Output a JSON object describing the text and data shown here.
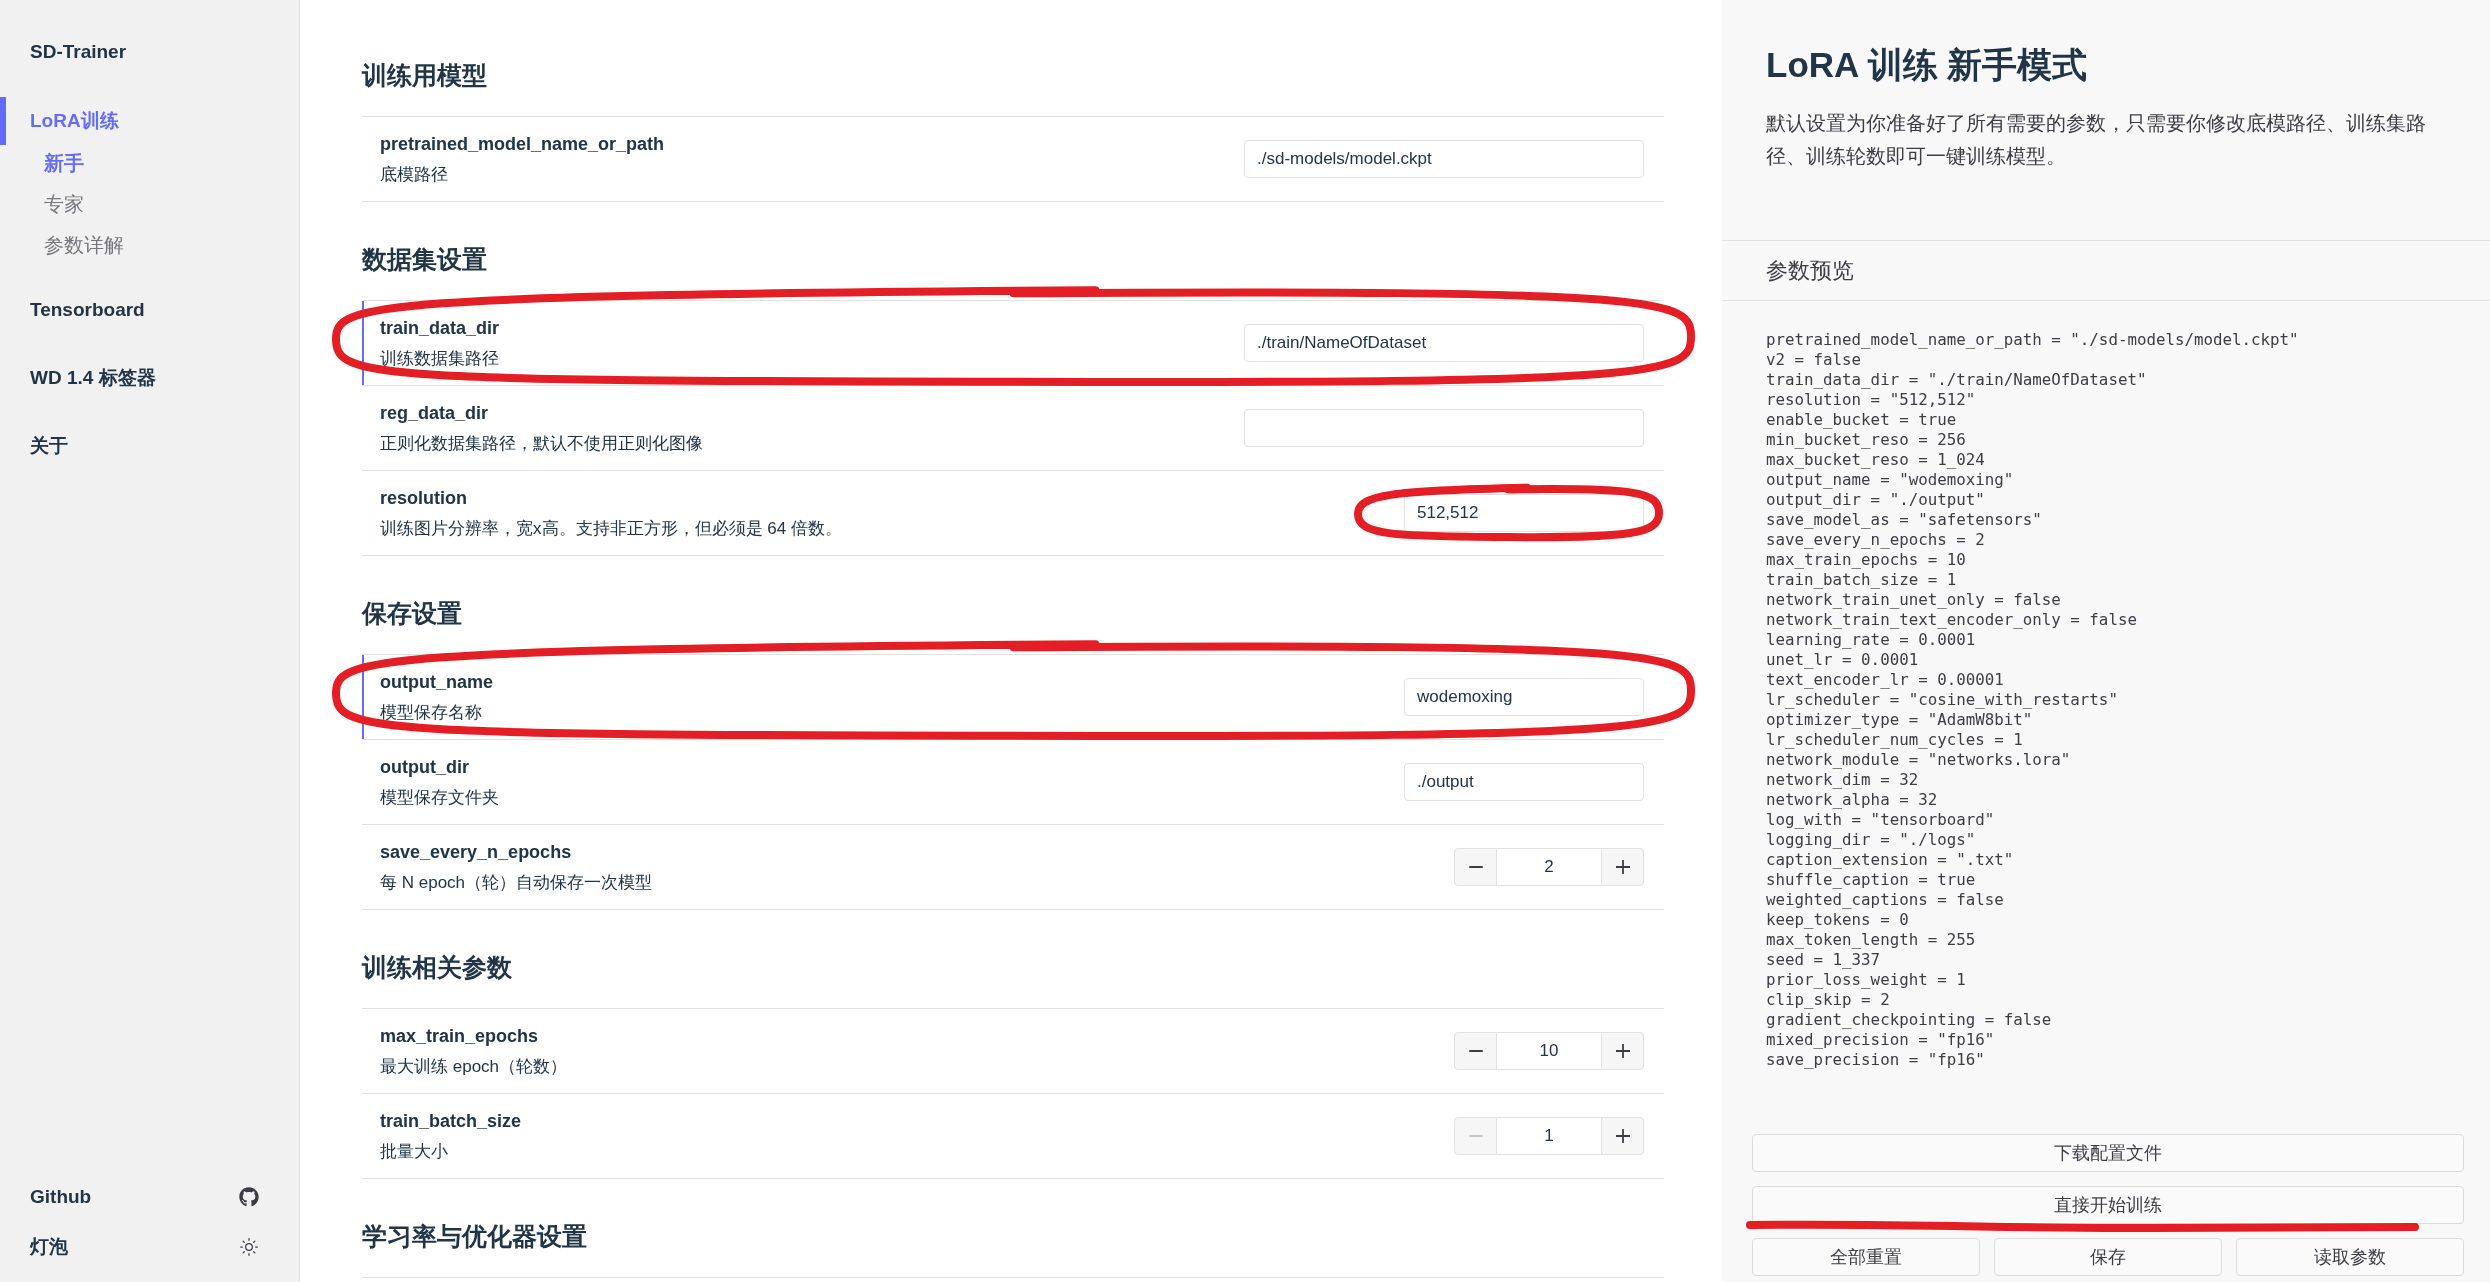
{
  "sidebar": {
    "title": "SD-Trainer",
    "items": [
      {
        "label": "LoRA训练",
        "selected": true,
        "children": [
          {
            "label": "新手",
            "selected": true
          },
          {
            "label": "专家",
            "selected": false
          },
          {
            "label": "参数详解",
            "selected": false
          }
        ]
      },
      {
        "label": "Tensorboard",
        "selected": false
      },
      {
        "label": "WD 1.4 标签器",
        "selected": false
      },
      {
        "label": "关于",
        "selected": false
      }
    ],
    "footer": [
      {
        "label": "Github",
        "kind": "github"
      },
      {
        "label": "灯泡",
        "kind": "theme"
      }
    ]
  },
  "form": {
    "sections": [
      {
        "title": "训练用模型",
        "rows": [
          {
            "name": "pretrained_model_name_or_path",
            "description": "底模路径",
            "modified": false,
            "circled": false,
            "field": {
              "kind": "path",
              "value": "./sd-models/model.ckpt",
              "circled": false
            }
          }
        ]
      },
      {
        "title": "数据集设置",
        "rows": [
          {
            "name": "train_data_dir",
            "description": "训练数据集路径",
            "modified": true,
            "circled": true,
            "field": {
              "kind": "path",
              "value": "./train/NameOfDataset",
              "circled": false
            }
          },
          {
            "name": "reg_data_dir",
            "description": "正则化数据集路径，默认不使用正则化图像",
            "modified": false,
            "circled": false,
            "field": {
              "kind": "path",
              "circled": false
            }
          },
          {
            "name": "resolution",
            "description": "训练图片分辨率，宽x高。支持非正方形，但必须是 64 倍数。",
            "modified": false,
            "circled": false,
            "field": {
              "kind": "text",
              "value": "512,512",
              "circled": true
            }
          }
        ]
      },
      {
        "title": "保存设置",
        "rows": [
          {
            "name": "output_name",
            "description": "模型保存名称",
            "modified": true,
            "circled": true,
            "field": {
              "kind": "text",
              "value": "wodemoxing",
              "circled": false
            }
          },
          {
            "name": "output_dir",
            "description": "模型保存文件夹",
            "modified": false,
            "circled": false,
            "field": {
              "kind": "text",
              "value": "./output",
              "circled": false
            }
          },
          {
            "name": "save_every_n_epochs",
            "description": "每 N epoch（轮）自动保存一次模型",
            "modified": false,
            "circled": false,
            "field": {
              "kind": "number",
              "value": "2",
              "decrement_disabled": false,
              "circled": false
            }
          }
        ]
      },
      {
        "title": "训练相关参数",
        "rows": [
          {
            "name": "max_train_epochs",
            "description": "最大训练 epoch（轮数）",
            "modified": false,
            "circled": false,
            "field": {
              "kind": "number",
              "value": "10",
              "decrement_disabled": false,
              "circled": false
            }
          },
          {
            "name": "train_batch_size",
            "description": "批量大小",
            "modified": false,
            "circled": false,
            "field": {
              "kind": "number",
              "value": "1",
              "decrement_disabled": true,
              "circled": false
            }
          }
        ]
      },
      {
        "title": "学习率与优化器设置"
      }
    ]
  },
  "panel": {
    "title": "LoRA 训练 新手模式",
    "description": "默认设置为你准备好了所有需要的参数，只需要你修改底模路径、训练集路径、训练轮数即可一键训练模型。",
    "preview_title": "参数预览",
    "preview_lines": [
      "pretrained_model_name_or_path = \"./sd-models/model.ckpt\"",
      "v2 = false",
      "train_data_dir = \"./train/NameOfDataset\"",
      "resolution = \"512,512\"",
      "enable_bucket = true",
      "min_bucket_reso = 256",
      "max_bucket_reso = 1_024",
      "output_name = \"wodemoxing\"",
      "output_dir = \"./output\"",
      "save_model_as = \"safetensors\"",
      "save_every_n_epochs = 2",
      "max_train_epochs = 10",
      "train_batch_size = 1",
      "network_train_unet_only = false",
      "network_train_text_encoder_only = false",
      "learning_rate = 0.0001",
      "unet_lr = 0.0001",
      "text_encoder_lr = 0.00001",
      "lr_scheduler = \"cosine_with_restarts\"",
      "optimizer_type = \"AdamW8bit\"",
      "lr_scheduler_num_cycles = 1",
      "network_module = \"networks.lora\"",
      "network_dim = 32",
      "network_alpha = 32",
      "log_with = \"tensorboard\"",
      "logging_dir = \"./logs\"",
      "caption_extension = \".txt\"",
      "shuffle_caption = true",
      "weighted_captions = false",
      "keep_tokens = 0",
      "max_token_length = 255",
      "seed = 1_337",
      "prior_loss_weight = 1",
      "clip_skip = 2",
      "gradient_checkpointing = false",
      "mixed_precision = \"fp16\"",
      "save_precision = \"fp16\""
    ],
    "button_rows": [
      [
        {
          "label": "下载配置文件",
          "underlined": false
        }
      ],
      [
        {
          "label": "直接开始训练",
          "underlined": true
        }
      ],
      [
        {
          "label": "全部重置",
          "underlined": false
        },
        {
          "label": "保存",
          "underlined": false
        },
        {
          "label": "读取参数",
          "underlined": false
        }
      ]
    ]
  }
}
